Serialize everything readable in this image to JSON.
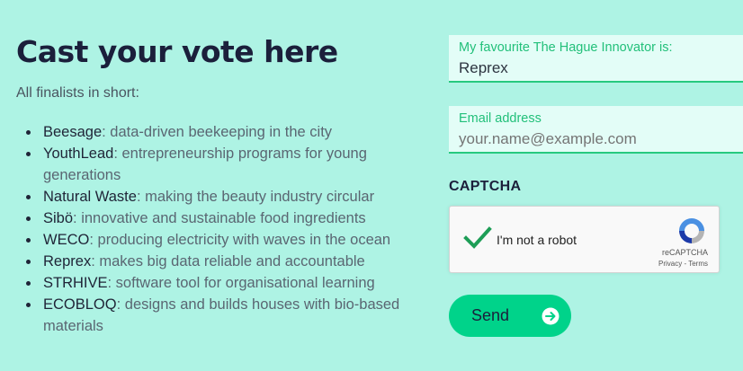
{
  "heading": "Cast your vote here",
  "subtitle": "All finalists in short:",
  "finalists": [
    {
      "name": "Beesage",
      "desc": ": data-driven beekeeping in the city"
    },
    {
      "name": "YouthLead",
      "desc": ": entrepreneurship programs for young generations"
    },
    {
      "name": "Natural Waste",
      "desc": ": making the beauty industry circular"
    },
    {
      "name": "Sibö",
      "desc": ": innovative and sustainable food ingredients"
    },
    {
      "name": "WECO",
      "desc": ": producing electricity with waves in the ocean"
    },
    {
      "name": "Reprex",
      "desc": ": makes big data reliable and accountable"
    },
    {
      "name": "STRHIVE",
      "desc": ": software tool for organisational learning"
    },
    {
      "name": "ECOBLOQ",
      "desc": ": designs and builds houses with bio-based materials"
    }
  ],
  "form": {
    "favourite": {
      "label": "My favourite The Hague Innovator is:",
      "value": "Reprex"
    },
    "email": {
      "label": "Email address",
      "placeholder": "your.name@example.com"
    },
    "captcha_title": "CAPTCHA",
    "recaptcha": {
      "label": "I'm not a robot",
      "brand": "reCAPTCHA",
      "privacy": "Privacy",
      "terms": "Terms",
      "checked": true
    },
    "send_label": "Send"
  },
  "colors": {
    "background": "#aef3e4",
    "accent": "#27c97f",
    "button": "#00d38a",
    "heading": "#1b1f3b"
  }
}
